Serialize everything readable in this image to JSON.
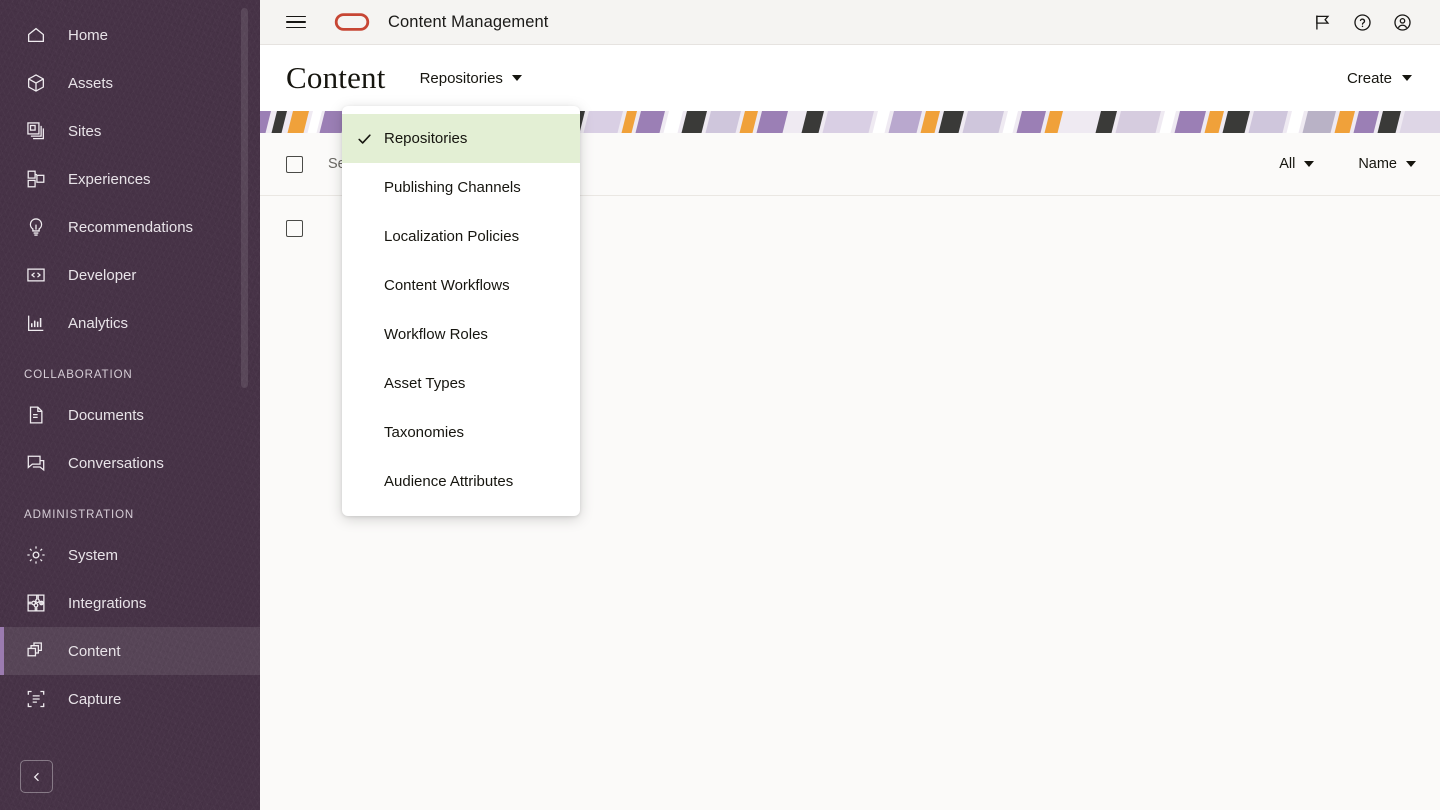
{
  "sidebar": {
    "items": [
      {
        "label": "Home",
        "icon": "home-icon",
        "active": false
      },
      {
        "label": "Assets",
        "icon": "cube-icon",
        "active": false
      },
      {
        "label": "Sites",
        "icon": "sites-icon",
        "active": false
      },
      {
        "label": "Experiences",
        "icon": "experiences-icon",
        "active": false
      },
      {
        "label": "Recommendations",
        "icon": "lightbulb-icon",
        "active": false
      },
      {
        "label": "Developer",
        "icon": "code-icon",
        "active": false
      },
      {
        "label": "Analytics",
        "icon": "bar-chart-icon",
        "active": false
      }
    ],
    "sections": [
      {
        "title": "COLLABORATION",
        "items": [
          {
            "label": "Documents",
            "icon": "document-icon",
            "active": false
          },
          {
            "label": "Conversations",
            "icon": "conversation-icon",
            "active": false
          }
        ]
      },
      {
        "title": "ADMINISTRATION",
        "items": [
          {
            "label": "System",
            "icon": "gear-icon",
            "active": false
          },
          {
            "label": "Integrations",
            "icon": "integrations-icon",
            "active": false
          },
          {
            "label": "Content",
            "icon": "content-icon",
            "active": true
          },
          {
            "label": "Capture",
            "icon": "capture-icon",
            "active": false
          }
        ]
      }
    ],
    "collapse_icon": "chevron-left-icon",
    "active_accent_color": "#9b7bb0",
    "background_color": "#463246"
  },
  "header": {
    "menu_icon": "hamburger-icon",
    "logo_icon": "oracle-logo-icon",
    "logo_color": "#C74634",
    "app_title": "Content Management",
    "actions": [
      {
        "name": "flag-icon",
        "icon": "flag-icon"
      },
      {
        "name": "help-icon",
        "icon": "question-circle-icon"
      },
      {
        "name": "account-icon",
        "icon": "user-circle-icon"
      }
    ]
  },
  "page": {
    "title": "Content",
    "switcher_label": "Repositories",
    "switcher_icon": "chevron-down-icon",
    "create_label": "Create",
    "create_icon": "chevron-down-icon"
  },
  "toolbar": {
    "select_all_checkbox": "unchecked",
    "search_placeholder": "Search",
    "search_value": "",
    "filter_label": "All",
    "filter_icon": "chevron-down-icon",
    "sort_label": "Name",
    "sort_icon": "chevron-down-icon"
  },
  "list": {
    "rows": [
      {
        "checkbox": "unchecked",
        "label": ""
      }
    ]
  },
  "dropdown": {
    "open": true,
    "selected": "Repositories",
    "selected_highlight_color": "#e3efd4",
    "check_icon": "check-icon",
    "items": [
      {
        "label": "Repositories",
        "selected": true
      },
      {
        "label": "Publishing Channels",
        "selected": false
      },
      {
        "label": "Localization Policies",
        "selected": false
      },
      {
        "label": "Content Workflows",
        "selected": false
      },
      {
        "label": "Workflow Roles",
        "selected": false
      },
      {
        "label": "Asset Types",
        "selected": false
      },
      {
        "label": "Taxonomies",
        "selected": false
      },
      {
        "label": "Audience Attributes",
        "selected": false
      }
    ]
  },
  "banner": {
    "description": "decorative abstract stripe collage",
    "colors": [
      "#9b7fb5",
      "#f0a13a",
      "#3a3a38",
      "#cfc6dc",
      "#ffffff",
      "#b9b2c6",
      "#d9cfe4"
    ]
  }
}
